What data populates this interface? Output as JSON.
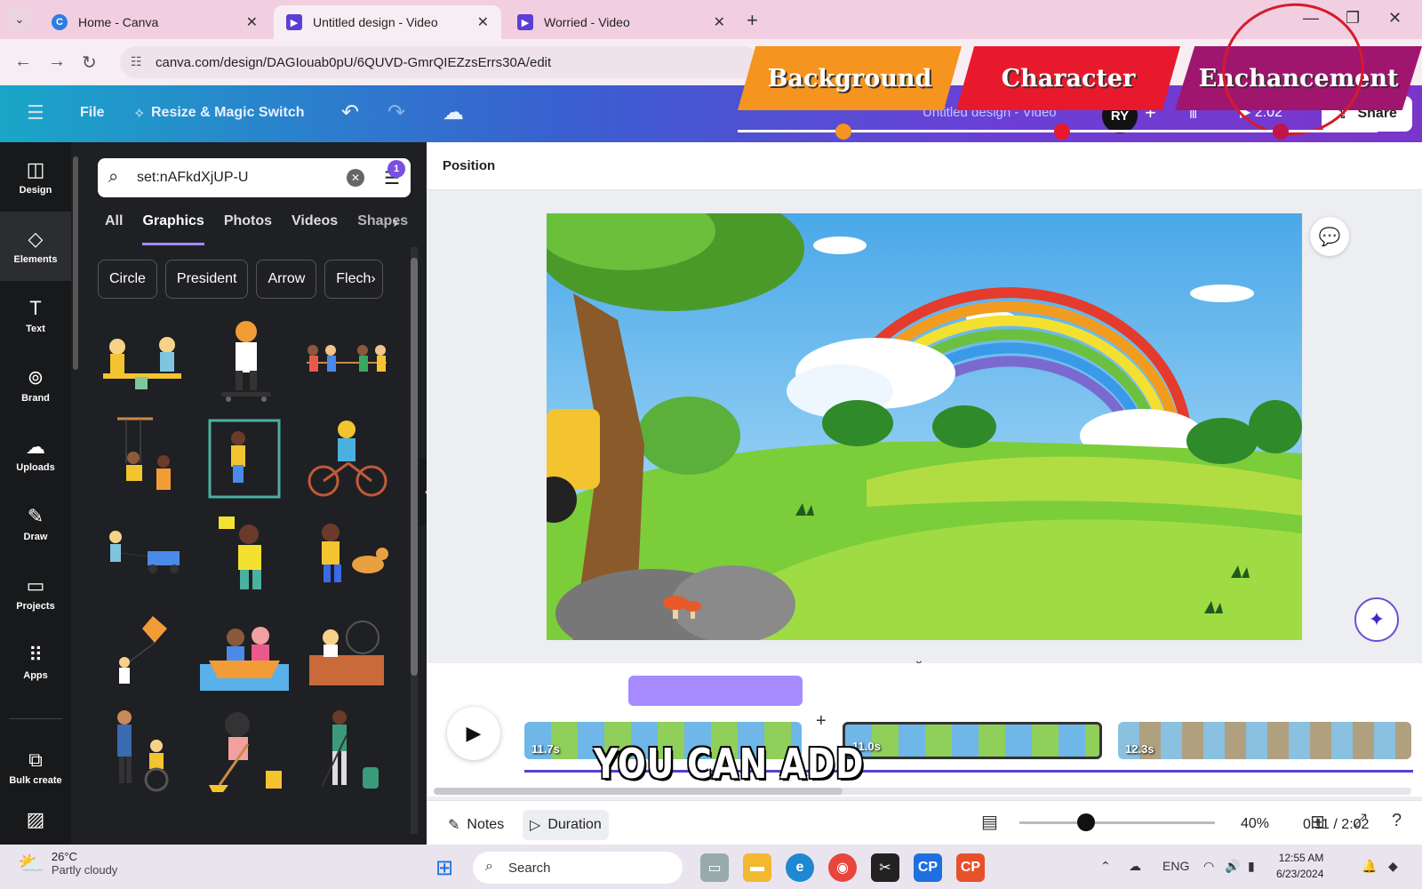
{
  "browser": {
    "tabs": [
      {
        "label": "Home - Canva",
        "favicon_color": "#2f7de1"
      },
      {
        "label": "Untitled design - Video",
        "favicon_color": "#5b3fd6"
      },
      {
        "label": "Worried - Video",
        "favicon_color": "#5b3fd6"
      }
    ],
    "url": "canva.com/design/DAGIouab0pU/6QUVD-GmrQIEZzsErrs30A/edit"
  },
  "topbar": {
    "file_label": "File",
    "resize_label": "Resize & Magic Switch",
    "design_title": "Untitled design - Video",
    "avatar_initials": "RY",
    "play_duration": "2:02",
    "share_label": "Share"
  },
  "overlay": {
    "banners": [
      {
        "label": "Background",
        "color": "#f5941f"
      },
      {
        "label": "Character",
        "color": "#e8192c"
      },
      {
        "label": "Enchancement",
        "color": "#a0166f"
      }
    ],
    "progress_dot_colors": [
      "#f5941f",
      "#e8192c",
      "#c0144a"
    ]
  },
  "sidebar": {
    "items": [
      {
        "label": "Design",
        "icon": "design-icon"
      },
      {
        "label": "Elements",
        "icon": "elements-icon"
      },
      {
        "label": "Text",
        "icon": "text-icon"
      },
      {
        "label": "Brand",
        "icon": "brand-icon"
      },
      {
        "label": "Uploads",
        "icon": "uploads-icon"
      },
      {
        "label": "Draw",
        "icon": "draw-icon"
      },
      {
        "label": "Projects",
        "icon": "projects-icon"
      },
      {
        "label": "Apps",
        "icon": "apps-icon"
      },
      {
        "label": "Bulk create",
        "icon": "bulk-create-icon"
      }
    ]
  },
  "panel": {
    "search_value": "set:nAFkdXjUP-U",
    "filter_badge": "1",
    "tabs": [
      "All",
      "Graphics",
      "Photos",
      "Videos",
      "Shapes"
    ],
    "active_tab": "Graphics",
    "chips": [
      "Circle",
      "President",
      "Arrow",
      "Flech"
    ]
  },
  "workspace": {
    "position_label": "Position"
  },
  "timeline": {
    "clips": [
      "11.7s",
      "11.0s",
      "12.3s"
    ],
    "caption": "YOU CAN ADD"
  },
  "bottombar": {
    "notes_label": "Notes",
    "duration_label": "Duration",
    "time": "0:11 / 2:02",
    "zoom": "40%"
  },
  "taskbar": {
    "temperature": "26°C",
    "weather": "Partly cloudy",
    "search_label": "Search",
    "language": "ENG",
    "time": "12:55 AM",
    "date": "6/23/2024"
  }
}
